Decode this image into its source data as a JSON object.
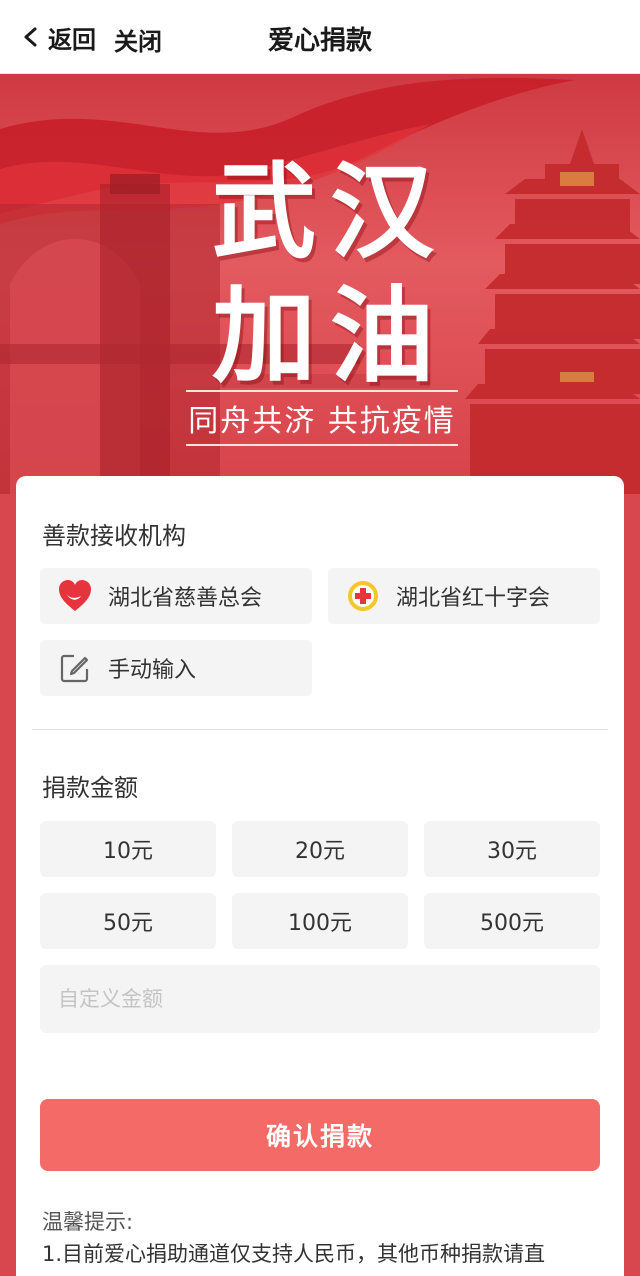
{
  "header": {
    "back_label": "返回",
    "close_label": "关闭",
    "title": "爱心捐款"
  },
  "banner": {
    "title_line1": "武汉",
    "title_line2": "加油",
    "slogan": "同舟共济 共抗疫情",
    "colors": {
      "primary": "#d9474e",
      "accent": "#f46a67"
    }
  },
  "organizations": {
    "label": "善款接收机构",
    "items": [
      {
        "label": "湖北省慈善总会",
        "icon": "heart-charity-icon"
      },
      {
        "label": "湖北省红十字会",
        "icon": "red-cross-icon"
      },
      {
        "label": "手动输入",
        "icon": "edit-icon"
      }
    ]
  },
  "amounts": {
    "label": "捐款金额",
    "options": [
      "10元",
      "20元",
      "30元",
      "50元",
      "100元",
      "500元"
    ],
    "custom_placeholder": "自定义金额"
  },
  "confirm_label": "确认捐款",
  "tips": {
    "title": "温馨提示:",
    "line1": "1.目前爱心捐助通道仅支持人民币，其他币种捐款请直"
  }
}
